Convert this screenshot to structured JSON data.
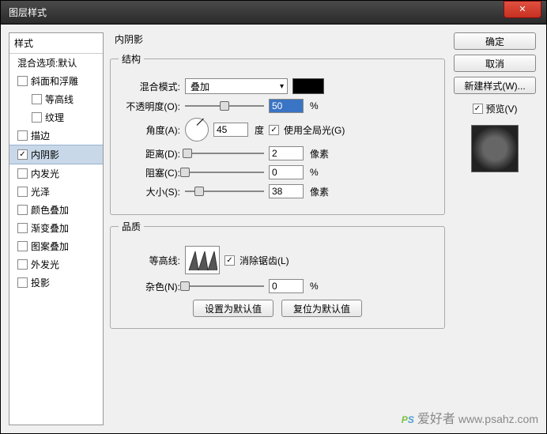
{
  "title": "图层样式",
  "sidebar": {
    "header": "样式",
    "blend_opts": "混合选项:默认",
    "items": [
      {
        "label": "斜面和浮雕",
        "checked": false,
        "indent": false
      },
      {
        "label": "等高线",
        "checked": false,
        "indent": true
      },
      {
        "label": "纹理",
        "checked": false,
        "indent": true
      },
      {
        "label": "描边",
        "checked": false,
        "indent": false
      },
      {
        "label": "内阴影",
        "checked": true,
        "indent": false,
        "selected": true
      },
      {
        "label": "内发光",
        "checked": false,
        "indent": false
      },
      {
        "label": "光泽",
        "checked": false,
        "indent": false
      },
      {
        "label": "颜色叠加",
        "checked": false,
        "indent": false
      },
      {
        "label": "渐变叠加",
        "checked": false,
        "indent": false
      },
      {
        "label": "图案叠加",
        "checked": false,
        "indent": false
      },
      {
        "label": "外发光",
        "checked": false,
        "indent": false
      },
      {
        "label": "投影",
        "checked": false,
        "indent": false
      }
    ]
  },
  "panel": {
    "title": "内阴影",
    "structure_legend": "结构",
    "blend_mode_label": "混合模式:",
    "blend_mode_value": "叠加",
    "opacity_label": "不透明度(O):",
    "opacity_value": "50",
    "opacity_unit": "%",
    "angle_label": "角度(A):",
    "angle_value": "45",
    "angle_unit": "度",
    "global_light_label": "使用全局光(G)",
    "distance_label": "距离(D):",
    "distance_value": "2",
    "distance_unit": "像素",
    "choke_label": "阻塞(C):",
    "choke_value": "0",
    "choke_unit": "%",
    "size_label": "大小(S):",
    "size_value": "38",
    "size_unit": "像素",
    "quality_legend": "品质",
    "contour_label": "等高线:",
    "antialias_label": "消除锯齿(L)",
    "noise_label": "杂色(N):",
    "noise_value": "0",
    "noise_unit": "%",
    "set_default": "设置为默认值",
    "reset_default": "复位为默认值"
  },
  "buttons": {
    "ok": "确定",
    "cancel": "取消",
    "new_style": "新建样式(W)...",
    "preview_label": "预览(V)"
  },
  "watermark": {
    "cn": "爱好者",
    "url": "www.psahz.com"
  }
}
